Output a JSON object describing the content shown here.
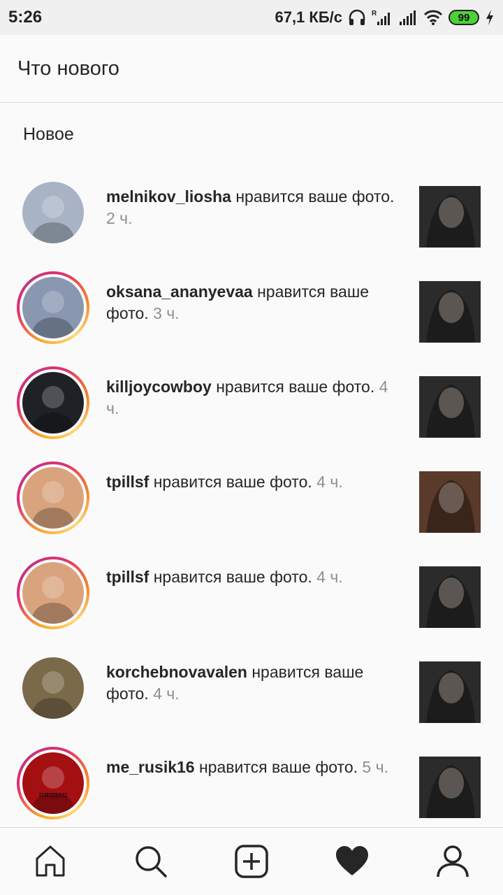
{
  "status_bar": {
    "time": "5:26",
    "speed": "67,1 КБ/с",
    "battery": "99",
    "icons": [
      "headphones-icon",
      "signal-icon",
      "signal-icon",
      "wifi-icon",
      "battery-icon",
      "charging-icon"
    ]
  },
  "header": {
    "title": "Что нового"
  },
  "section": {
    "title": "Новое"
  },
  "notifications": [
    {
      "user": "melnikov_liosha",
      "action": "нравится ваше фото.",
      "time": "2 ч.",
      "story_ring": false,
      "avatar_color": "#a8b4c6",
      "thumb_color": "#2b2b2b"
    },
    {
      "user": "oksana_ananyevaa",
      "action": "нравится ваше фото.",
      "time": "3 ч.",
      "story_ring": true,
      "avatar_color": "#8a97b0",
      "thumb_color": "#2b2b2b"
    },
    {
      "user": "killjoycowboy",
      "action": "нравится ваше фото.",
      "time": "4 ч.",
      "story_ring": true,
      "avatar_color": "#1e2126",
      "thumb_color": "#2b2b2b"
    },
    {
      "user": "tpillsf",
      "action": "нравится ваше фото.",
      "time": "4 ч.",
      "story_ring": true,
      "avatar_color": "#d9a37e",
      "thumb_color": "#5a3a2a"
    },
    {
      "user": "tpillsf",
      "action": "нравится ваше фото.",
      "time": "4 ч.",
      "story_ring": true,
      "avatar_color": "#d9a37e",
      "thumb_color": "#2b2b2b"
    },
    {
      "user": "korchebnovavalen",
      "action": "нравится ваше фото.",
      "time": "4 ч.",
      "story_ring": false,
      "avatar_color": "#7b6a4a",
      "thumb_color": "#2b2b2b"
    },
    {
      "user": "me_rusik16",
      "action": "нравится ваше фото.",
      "time": "5 ч.",
      "story_ring": true,
      "avatar_color": "#a40f12",
      "avatar_caption": "пиздец",
      "thumb_color": "#2b2b2b"
    }
  ],
  "bottom_nav": [
    {
      "name": "home-icon",
      "active": false
    },
    {
      "name": "search-icon",
      "active": false
    },
    {
      "name": "add-post-icon",
      "active": false
    },
    {
      "name": "heart-icon",
      "active": true
    },
    {
      "name": "profile-icon",
      "active": false
    }
  ]
}
